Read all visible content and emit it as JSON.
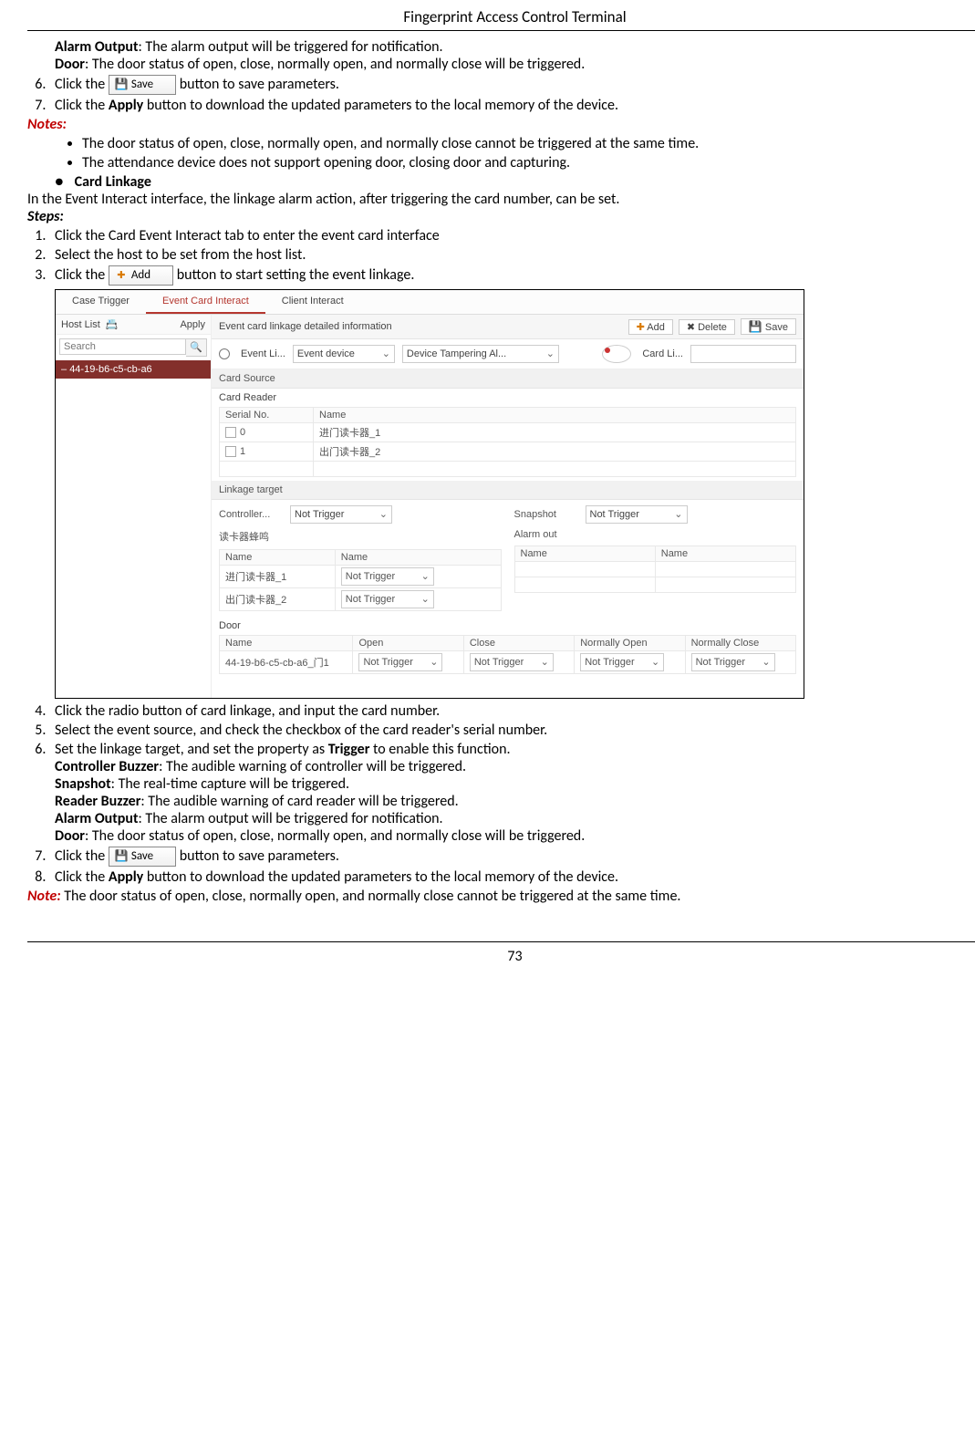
{
  "header": "Fingerprint Access Control Terminal",
  "page_number": "73",
  "top": {
    "alarm_output_label": "Alarm Output",
    "alarm_output_text": ": The alarm output will be triggered for notification.",
    "door_label": "Door",
    "door_text": ": The door status of open, close, normally open, and normally close will be triggered."
  },
  "ol1": {
    "item6_a": "Click the ",
    "item6_b": " button to save parameters.",
    "item7_a": "Click the ",
    "item7_apply": "Apply",
    "item7_b": " button to download the updated parameters to the local memory of the device."
  },
  "notes_label": "Notes:",
  "notes": {
    "n1": "The door status of open, close, normally open, and normally close cannot be triggered at the same time.",
    "n2": "The attendance device does not support opening door, closing door and capturing."
  },
  "card_linkage_heading": "Card Linkage",
  "card_intro": "In the Event Interact interface, the linkage alarm action, after triggering the card number, can be set.",
  "steps_label": "Steps:",
  "ol2": {
    "s1": "Click the Card Event Interact tab to enter the event card interface",
    "s2": "Select the host to be set from the host list.",
    "s3a": "Click the ",
    "s3b": " button to start setting the event linkage.",
    "s4": "Click the radio button of card linkage, and input the card number.",
    "s5": "Select the event source, and check the checkbox of the card reader's serial number.",
    "s6_a": "Set the linkage target, and set the property as ",
    "s6_trigger": "Trigger",
    "s6_b": " to enable this function.",
    "prop": {
      "cb_l": "Controller Buzzer",
      "cb_t": ": The audible warning of controller will be triggered.",
      "sn_l": "Snapshot",
      "sn_t": ": The real-time capture will be triggered.",
      "rb_l": "Reader Buzzer",
      "rb_t": ": The audible warning of card reader will be triggered.",
      "ao_l": "Alarm Output",
      "ao_t": ": The alarm output will be triggered for notification.",
      "dr_l": "Door",
      "dr_t": ": The door status of open, close, normally open, and normally close will be triggered."
    },
    "s7a": "Click the ",
    "s7b": " button to save parameters.",
    "s8a": "Click the ",
    "s8_apply": "Apply",
    "s8b": " button to download the updated parameters to the local memory of the device."
  },
  "note2_label": "Note:",
  "note2_text": " The door status of open, close, normally open, and normally close cannot be triggered at the same time.",
  "btn": {
    "save": "Save",
    "add": "Add"
  },
  "scr": {
    "tabs": {
      "t1": "Case Trigger",
      "t2": "Event Card Interact",
      "t3": "Client Interact"
    },
    "hostlist": "Host List",
    "apply": "Apply",
    "search_ph": "Search",
    "host": "44-19-b6-c5-cb-a6",
    "bartitle": "Event card linkage detailed information",
    "badd": "Add",
    "bdel": "Delete",
    "bsave": "Save",
    "eventli": "Event Li...",
    "eventdev": "Event device",
    "devtamper": "Device Tampering Al...",
    "cardli": "Card Li...",
    "cardsource": "Card Source",
    "cardreader": "Card Reader",
    "serialno": "Serial No.",
    "name": "Name",
    "r0": "0",
    "r0n": "进门读卡器_1",
    "r1": "1",
    "r1n": "出门读卡器_2",
    "linkagetarget": "Linkage target",
    "controller": "Controller...",
    "snapshot": "Snapshot",
    "nottrigger": "Not Trigger",
    "readerbuzzer": "读卡器蜂鸣",
    "alarmout": "Alarm out",
    "reader1": "进门读卡器_1",
    "reader2": "出门读卡器_2",
    "door": "Door",
    "open": "Open",
    "close": "Close",
    "nopen": "Normally Open",
    "nclose": "Normally Close",
    "doorname": "44-19-b6-c5-cb-a6_门1"
  }
}
